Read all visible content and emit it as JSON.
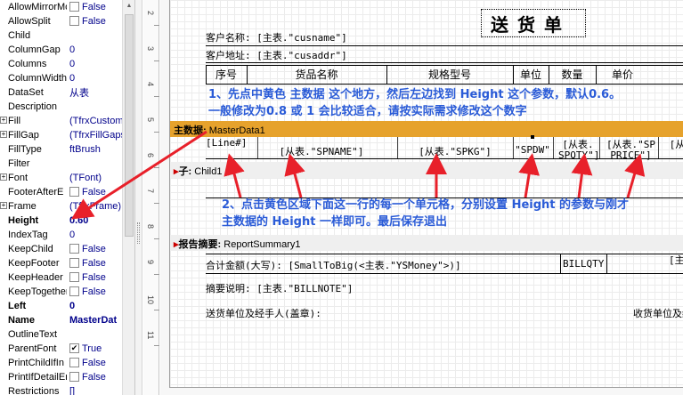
{
  "inspector": {
    "properties": [
      {
        "name": "AllowMirrorMo",
        "type": "check",
        "value": "False",
        "checked": false
      },
      {
        "name": "AllowSplit",
        "type": "check",
        "value": "False",
        "checked": false
      },
      {
        "name": "Child",
        "type": "text",
        "value": ""
      },
      {
        "name": "ColumnGap",
        "type": "text",
        "value": "0"
      },
      {
        "name": "Columns",
        "type": "text",
        "value": "0"
      },
      {
        "name": "ColumnWidth",
        "type": "text",
        "value": "0"
      },
      {
        "name": "DataSet",
        "type": "text",
        "value": "从表"
      },
      {
        "name": "Description",
        "type": "text",
        "value": ""
      },
      {
        "name": "Fill",
        "type": "text",
        "value": "(TfrxCustom",
        "expandable": true
      },
      {
        "name": "FillGap",
        "type": "text",
        "value": "(TfrxFillGaps",
        "expandable": true
      },
      {
        "name": "FillType",
        "type": "text",
        "value": "ftBrush"
      },
      {
        "name": "Filter",
        "type": "text",
        "value": ""
      },
      {
        "name": "Font",
        "type": "text",
        "value": "(TFont)",
        "expandable": true
      },
      {
        "name": "FooterAfterE",
        "type": "check",
        "value": "False",
        "checked": false
      },
      {
        "name": "Frame",
        "type": "text",
        "value": "(TfrxFrame)",
        "expandable": true
      },
      {
        "name": "Height",
        "type": "text",
        "value": "0.60",
        "bold": true
      },
      {
        "name": "IndexTag",
        "type": "text",
        "value": "0"
      },
      {
        "name": "KeepChild",
        "type": "check",
        "value": "False",
        "checked": false
      },
      {
        "name": "KeepFooter",
        "type": "check",
        "value": "False",
        "checked": false
      },
      {
        "name": "KeepHeader",
        "type": "check",
        "value": "False",
        "checked": false
      },
      {
        "name": "KeepTogether",
        "type": "check",
        "value": "False",
        "checked": false
      },
      {
        "name": "Left",
        "type": "text",
        "value": "0",
        "bold": true
      },
      {
        "name": "Name",
        "type": "text",
        "value": "MasterDat",
        "bold": true
      },
      {
        "name": "OutlineText",
        "type": "text",
        "value": ""
      },
      {
        "name": "ParentFont",
        "type": "check",
        "value": "True",
        "checked": true
      },
      {
        "name": "PrintChildIfIn",
        "type": "check",
        "value": "False",
        "checked": false
      },
      {
        "name": "PrintIfDetailEr",
        "type": "check",
        "value": "False",
        "checked": false
      },
      {
        "name": "Restrictions",
        "type": "text",
        "value": "[]"
      }
    ]
  },
  "ruler": {
    "ticks": [
      "2",
      "3",
      "4",
      "5",
      "6",
      "7",
      "8",
      "9",
      "10",
      "11"
    ]
  },
  "report": {
    "title": "送货单",
    "customer_name": "客户名称: [主表.\"cusname\"]",
    "customer_addr": "客户地址: [主表.\"cusaddr\"]",
    "headers": [
      "序号",
      "货品名称",
      "规格型号",
      "单位",
      "数量",
      "单价"
    ],
    "master_band": {
      "label": "主数据:",
      "name": "MasterData1",
      "color": "#e6a22c"
    },
    "master_cells": [
      "[Line#]",
      "[从表.\"SPNAME\"]",
      "[从表.\"SPKG\"]",
      "\"SPDW\"",
      "[从表.",
      "SPQTY\"]",
      "[从表.\"SP",
      "PRICE\"]",
      "[从表"
    ],
    "child_band": {
      "label": "子:",
      "name": "Child1"
    },
    "summary_band": {
      "label": "报告摘要:",
      "name": "ReportSummary1"
    },
    "total_amount": "合计金额(大写): [SmallToBig(<主表.\"YSMoney\">)]",
    "billqty": "BILLQTY",
    "summary_right": "[主表",
    "remark": "摘要说明: [主表.\"BILLNOTE\"]",
    "sender": "送货单位及经手人(盖章):",
    "receiver": "收货单位及经"
  },
  "annotations": {
    "note1_line1": "1、先点中黄色 主数据 这个地方，然后左边找到 Height 这个参数，默认0.6。",
    "note1_line2": "一般修改为0.8 或 1 会比较适合，请按实际需求修改这个数字",
    "note2_line1": "2、点击黄色区域下面这一行的每一个单元格，分别设置 Height 的参数与刚才",
    "note2_line2": "主数据的 Height 一样即可。最后保存退出",
    "note_color": "#2a5bd7",
    "arrow_color": "#e8202a"
  }
}
